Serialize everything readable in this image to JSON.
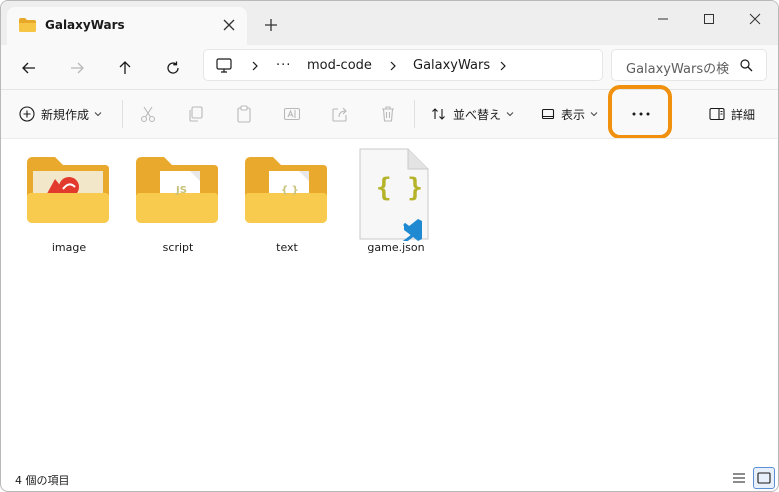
{
  "window": {
    "tab_title": "GalaxyWars",
    "new_tab": "+"
  },
  "address": {
    "crumbs": [
      "mod-code",
      "GalaxyWars"
    ],
    "overflow": "···",
    "search_placeholder": "GalaxyWarsの検"
  },
  "commands": {
    "new_label": "新規作成",
    "sort_label": "並べ替え",
    "view_label": "表示",
    "more_label": "···",
    "details_label": "詳細"
  },
  "files": [
    {
      "name": "image",
      "kind": "folder-image"
    },
    {
      "name": "script",
      "kind": "folder-script",
      "badge": "JS"
    },
    {
      "name": "text",
      "kind": "folder-text",
      "badge": "{ }"
    },
    {
      "name": "game.json",
      "kind": "json-file",
      "badge": "{ }"
    }
  ],
  "status": {
    "item_count": "4 個の項目"
  },
  "colors": {
    "folder": "#f6c544",
    "highlight": "#f0900c",
    "json_brace": "#b5b32a",
    "vscode": "#1f8ad2"
  }
}
